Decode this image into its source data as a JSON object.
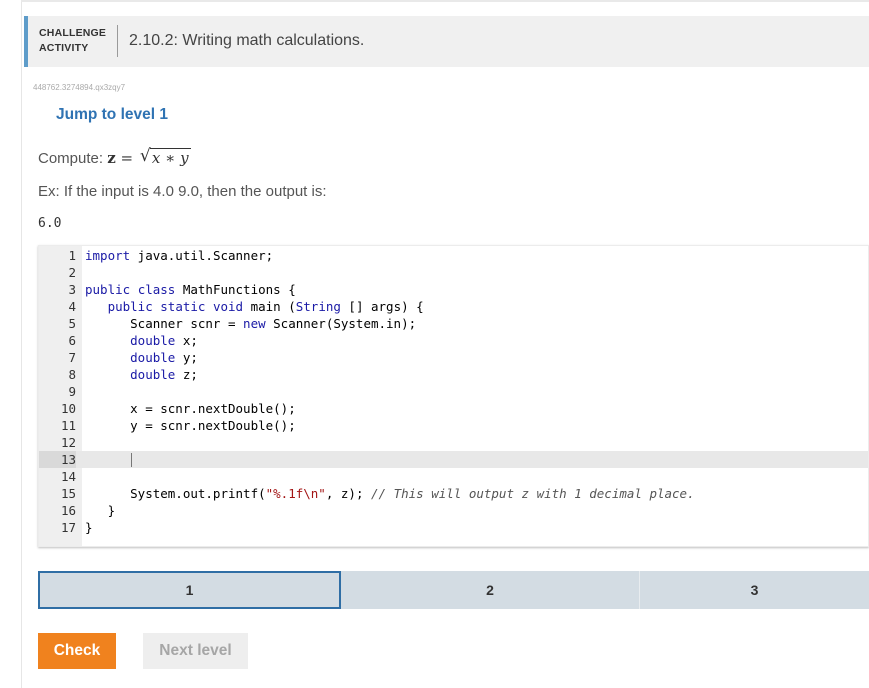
{
  "header": {
    "category_line1": "CHALLENGE",
    "category_line2": "ACTIVITY",
    "title": "2.10.2: Writing math calculations."
  },
  "activity_id": "448762.3274894.qx3zqy7",
  "jump_link": "Jump to level 1",
  "prompt": {
    "compute_label": "Compute:",
    "var": "z",
    "eq": "=",
    "radicand": "x ∗ y",
    "example": "Ex: If the input is 4.0 9.0, then the output is:",
    "output": "6.0"
  },
  "editor": {
    "active_line": 13,
    "lines": [
      {
        "n": "1",
        "t": "import java.util.Scanner;"
      },
      {
        "n": "2",
        "t": ""
      },
      {
        "n": "3",
        "t": "public class MathFunctions {"
      },
      {
        "n": "4",
        "t": "   public static void main (String [] args) {"
      },
      {
        "n": "5",
        "t": "      Scanner scnr = new Scanner(System.in);"
      },
      {
        "n": "6",
        "t": "      double x;"
      },
      {
        "n": "7",
        "t": "      double y;"
      },
      {
        "n": "8",
        "t": "      double z;"
      },
      {
        "n": "9",
        "t": ""
      },
      {
        "n": "10",
        "t": "      x = scnr.nextDouble();"
      },
      {
        "n": "11",
        "t": "      y = scnr.nextDouble();"
      },
      {
        "n": "12",
        "t": ""
      },
      {
        "n": "13",
        "t": ""
      },
      {
        "n": "14",
        "t": ""
      },
      {
        "n": "15",
        "t": "      System.out.printf(\"%.1f\\n\", z); // This will output z with 1 decimal place."
      },
      {
        "n": "16",
        "t": "   }"
      },
      {
        "n": "17",
        "t": "}"
      }
    ]
  },
  "levels": [
    {
      "label": "1",
      "selected": true
    },
    {
      "label": "2",
      "selected": false
    },
    {
      "label": "3",
      "selected": false
    }
  ],
  "buttons": {
    "check": "Check",
    "next": "Next level"
  },
  "colors": {
    "accent": "#5e9cc9",
    "link": "#2f73b3",
    "check_button": "#f0821e",
    "level_selected_border": "#2f6ea5",
    "level_bg": "#d3dce3"
  }
}
